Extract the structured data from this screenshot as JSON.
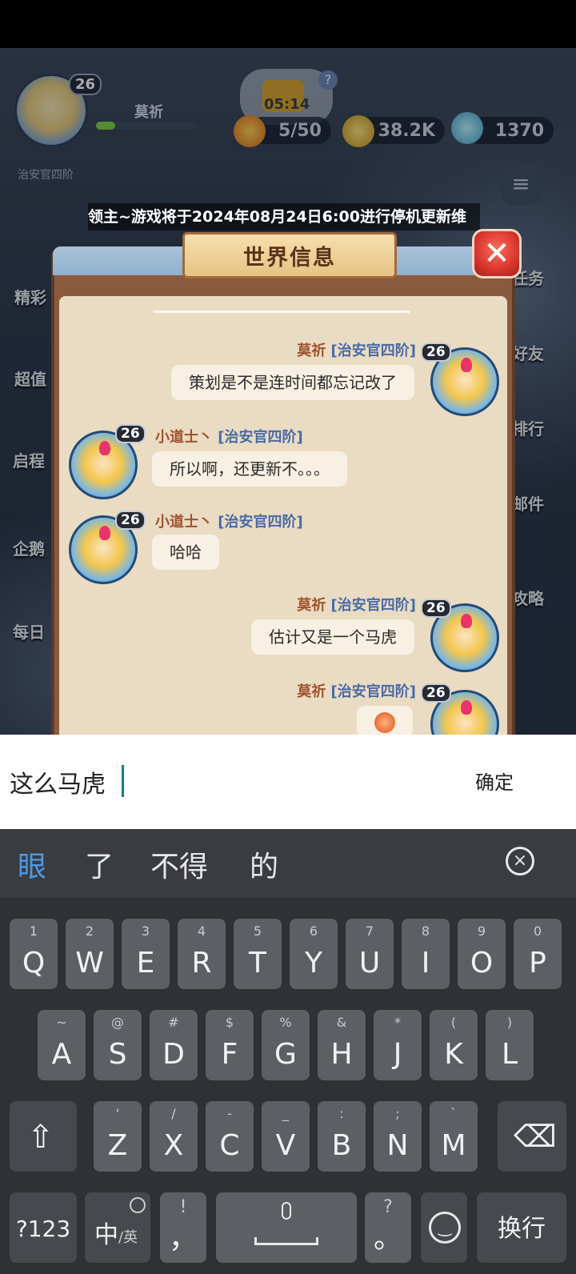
{
  "player": {
    "name": "莫祈",
    "level": "26",
    "rank": "治安官四阶"
  },
  "timer": "05:14",
  "resources": {
    "stamina": "5/50",
    "gold": "38.2K",
    "gems": "1370"
  },
  "side_left": [
    "精彩",
    "超值",
    "启程",
    "企鹅",
    "每日"
  ],
  "side_right": [
    "任务",
    "好友",
    "排行",
    "邮件",
    "攻略"
  ],
  "marquee": "领主~游戏将于2024年08月24日6:00进行停机更新维",
  "dialog": {
    "title": "世界信息",
    "messages": [
      {
        "side": "right",
        "name": "莫祈",
        "rank": "[治安官四阶]",
        "level": "26",
        "text": "策划是不是连时间都忘记改了"
      },
      {
        "side": "left",
        "name": "小道士丶",
        "rank": "[治安官四阶]",
        "level": "26",
        "text": "所以啊，还更新不。。。"
      },
      {
        "side": "left",
        "name": "小道士丶",
        "rank": "[治安官四阶]",
        "level": "26",
        "text": "哈哈"
      },
      {
        "side": "right",
        "name": "莫祈",
        "rank": "[治安官四阶]",
        "level": "26",
        "text": "估计又是一个马虎"
      },
      {
        "side": "right",
        "name": "莫祈",
        "rank": "[治安官四阶]",
        "level": "26",
        "text": ""
      }
    ]
  },
  "input": {
    "value": "这么马虎",
    "confirm_label": "确定"
  },
  "keyboard": {
    "suggestions": [
      "眼",
      "了",
      "不得",
      "的"
    ],
    "row1": [
      [
        "Q",
        "1"
      ],
      [
        "W",
        "2"
      ],
      [
        "E",
        "3"
      ],
      [
        "R",
        "4"
      ],
      [
        "T",
        "5"
      ],
      [
        "Y",
        "6"
      ],
      [
        "U",
        "7"
      ],
      [
        "I",
        "8"
      ],
      [
        "O",
        "9"
      ],
      [
        "P",
        "0"
      ]
    ],
    "row2": [
      [
        "A",
        "~"
      ],
      [
        "S",
        "@"
      ],
      [
        "D",
        "#"
      ],
      [
        "F",
        "$"
      ],
      [
        "G",
        "%"
      ],
      [
        "H",
        "&"
      ],
      [
        "J",
        "*"
      ],
      [
        "K",
        "("
      ],
      [
        "L",
        ")"
      ]
    ],
    "row3": [
      [
        "Z",
        "'"
      ],
      [
        "X",
        "/"
      ],
      [
        "C",
        "-"
      ],
      [
        "V",
        "_"
      ],
      [
        "B",
        ":"
      ],
      [
        "N",
        ";"
      ],
      [
        "M",
        "`"
      ]
    ],
    "bottom": {
      "sym": "?123",
      "lang_main": "中",
      "lang_sub": "/英",
      "comma": "，",
      "comma_hint": "!",
      "period": "。",
      "period_hint": "?",
      "enter": "换行"
    }
  }
}
